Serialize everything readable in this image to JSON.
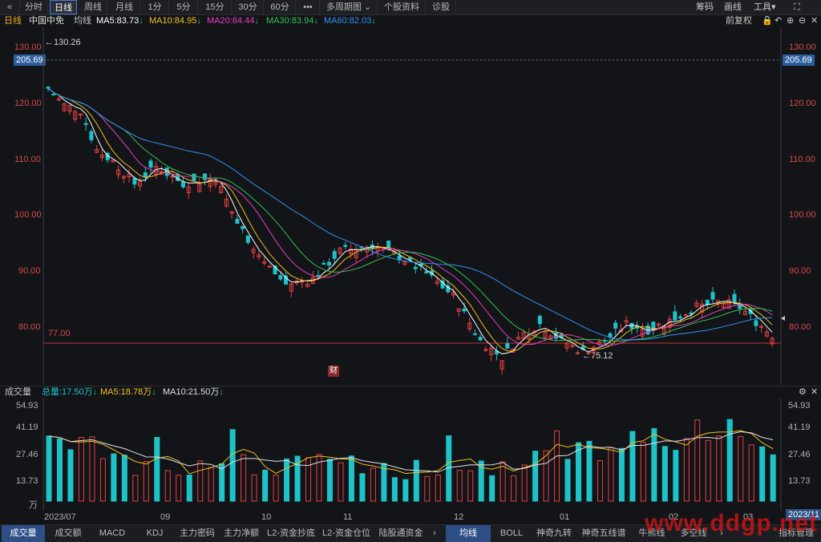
{
  "toolbar": {
    "items": [
      "«",
      "分时",
      "日线",
      "周线",
      "月线",
      "1分",
      "5分",
      "15分",
      "30分",
      "60分",
      "•••",
      "多周期图",
      "个股资料",
      "诊股"
    ],
    "active": "日线",
    "right_items": [
      "筹码",
      "画线",
      "工具"
    ]
  },
  "info": {
    "period": "日线",
    "stock": "中国中免",
    "ma_label": "均线",
    "ma5": "MA5:83.73",
    "ma10": "MA10:84.95",
    "ma20": "MA20:84.44",
    "ma30": "MA30:83.94",
    "ma60": "MA60:82.03",
    "adjust": "前复权"
  },
  "price_axis": {
    "ticks": [
      "130.00",
      "120.00",
      "110.00",
      "100.00",
      "90.00",
      "80.00"
    ],
    "current": "205.69",
    "high_mark": "←130.26",
    "low_mark": "←75.12",
    "support": "77.00",
    "event_badge": "财"
  },
  "volume": {
    "title": "成交量",
    "total": "总量:17.50万",
    "ma5": "MA5:18.78万",
    "ma10": "MA10:21.50万",
    "ticks": [
      "54.93",
      "41.19",
      "27.46",
      "13.73"
    ],
    "unit": "万"
  },
  "x_axis": {
    "labels": [
      "2023/07",
      "09",
      "10",
      "11",
      "12",
      "01",
      "02",
      "03"
    ],
    "corner": "2023/11"
  },
  "bottom_tabs": {
    "left": [
      "成交量",
      "成交额",
      "MACD",
      "KDJ",
      "主力密码",
      "主力净额",
      "L2-资金抄底",
      "L2-资金仓位",
      "陆股通资金"
    ],
    "right": [
      "均线",
      "BOLL",
      "神奇九转",
      "神奇五线谱",
      "牛熊线",
      "多空线",
      "指标管理"
    ],
    "active_left": "成交量",
    "active_right": "均线"
  },
  "colors": {
    "ma5": "#ffffff",
    "ma10": "#f0c020",
    "ma20": "#e040c0",
    "ma30": "#30c050",
    "ma60": "#3090f0",
    "up": "#e84040",
    "down": "#1ec3c8"
  },
  "watermark": "www.ddgp.net"
}
